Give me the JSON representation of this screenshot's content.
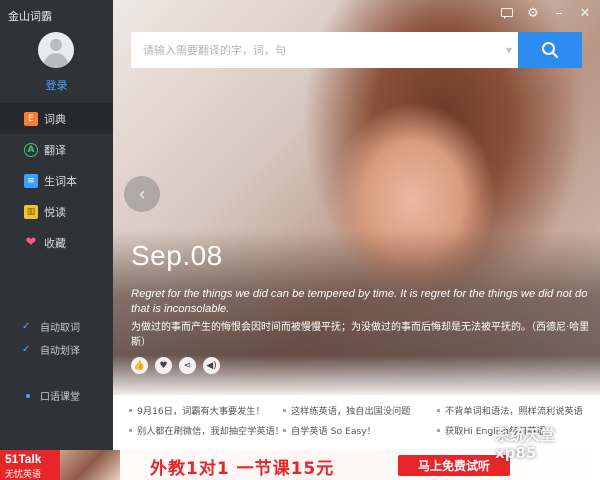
{
  "app": {
    "title": "金山词霸"
  },
  "user": {
    "login_label": "登录"
  },
  "sidebar": {
    "items": [
      {
        "label": "词典",
        "icon": "dictionary-icon"
      },
      {
        "label": "翻译",
        "icon": "translate-icon"
      },
      {
        "label": "生词本",
        "icon": "vocabulary-book-icon"
      },
      {
        "label": "悦读",
        "icon": "reading-icon"
      },
      {
        "label": "收藏",
        "icon": "heart-icon"
      }
    ],
    "active_index": 0,
    "options": [
      {
        "label": "自动取词",
        "checked": true
      },
      {
        "label": "自动划译",
        "checked": true
      }
    ],
    "oral_class": "口语课堂"
  },
  "search": {
    "placeholder": "请输入需要翻译的字，词，句"
  },
  "daily": {
    "date": "Sep.08",
    "quote_en": "Regret for the things we did can be tempered by time. It is regret for the things we did not do that is inconsolable.",
    "quote_cn": "为做过的事而产生的悔恨会因时间而被慢慢平抚；为没做过的事而后悔却是无法被平抚的。（西德尼·哈里斯）"
  },
  "news": [
    "9月16日，词霸有大事要发生！",
    "这样练英语，独自出国没问题",
    "不背单词和语法，照样流利说英语",
    "别人都在刷微信，我却抽空学英语！",
    "自学英语 So Easy！",
    "获取Hi English每日英语"
  ],
  "ad": {
    "brand": "51Talk",
    "brand_sub": "无忧英语",
    "headline": "外教1对1  一节课15元",
    "cta": "马上免费试听"
  },
  "watermark": {
    "line1": "系统天堂",
    "line2": "xp85"
  },
  "colors": {
    "accent": "#2d8cf0",
    "sidebar_bg": "#2f3237",
    "ad_red": "#e8262a"
  }
}
